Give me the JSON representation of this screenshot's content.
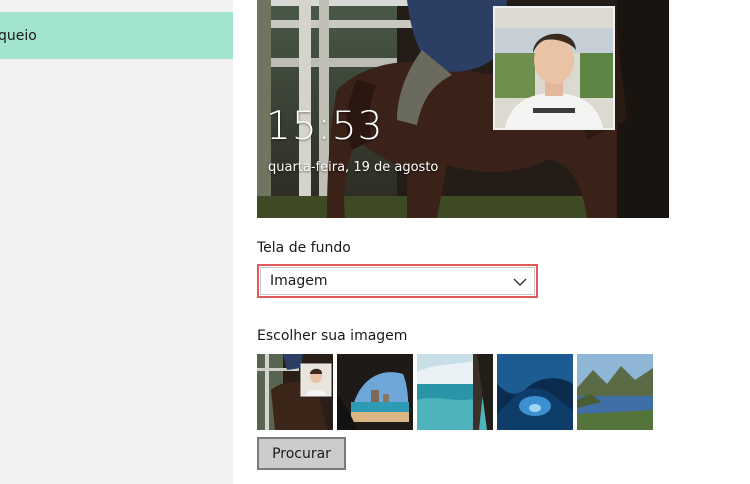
{
  "sidebar": {
    "items": [
      {
        "label": "queio",
        "selected": true
      }
    ],
    "accent_color": "#a3e4d0"
  },
  "lock_preview": {
    "time": "15:53",
    "date": "quarta-feira, 19 de agosto"
  },
  "background": {
    "label": "Tela de fundo",
    "selected_value": "Imagem"
  },
  "choose_image": {
    "label": "Escolher sua imagem",
    "thumbnails": [
      "horse-rider",
      "beach-cave",
      "ocean-cliff",
      "ice-cave",
      "mountain-lake"
    ]
  },
  "browse": {
    "label": "Procurar"
  }
}
